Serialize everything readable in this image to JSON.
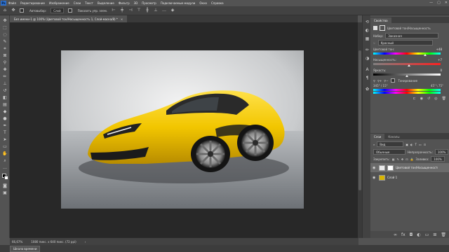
{
  "app": {
    "logo": "Ps"
  },
  "menu": [
    "Файл",
    "Редактирование",
    "Изображение",
    "Слои",
    "Текст",
    "Выделение",
    "Фильтр",
    "3D",
    "Просмотр",
    "Подключаемые модули",
    "Окно",
    "Справка"
  ],
  "window_controls": {
    "minimize": "—",
    "maximize": "▢",
    "close": "✕"
  },
  "options": {
    "autoselect_label": "Автовыбор:",
    "autoselect_value": "Слой",
    "transform_label": "Показать упр. элем."
  },
  "document_tab": {
    "title": "Без имени-1 @ 100% (Цветовой тон/Насыщенность 1, Слой-маска/8) *",
    "close": "×"
  },
  "status": {
    "zoom": "66,67%",
    "info": "1080 пикс. х 640 пикс. (72 ppi)"
  },
  "timeline_button": "Шкала времени",
  "properties": {
    "tabs": [
      "Свойства"
    ],
    "header": "Цветовой тон/Насыщенность",
    "preset_label": "Набор:",
    "preset_value": "Заказная",
    "channel_value": "Красный",
    "hue_label": "Цветовой тон:",
    "hue_value": "+48",
    "hue_level": 0.77,
    "saturation_label": "Насыщенность:",
    "saturation_value": "+7",
    "saturation_level": 0.535,
    "lightness_label": "Яркость:",
    "lightness_value": "0",
    "lightness_level": 0.5,
    "colorize_label": "Тонирование",
    "range_left": "345° / 15°",
    "range_right": "45° \\ 75°"
  },
  "layers": {
    "tabs": [
      "Слои",
      "Каналы"
    ],
    "search_value": "Вид",
    "blend_mode": "Обычные",
    "opacity_label": "Непрозрачность:",
    "opacity_value": "100%",
    "lock_label": "Закрепить:",
    "fill_label": "Заливка:",
    "fill_value": "100%",
    "items": [
      {
        "name": "Цветовой тон/Насыщенность 1"
      },
      {
        "name": "Слой 1"
      }
    ]
  },
  "colors": {
    "accent": "#2c6ecb",
    "car": "#f2c600"
  }
}
